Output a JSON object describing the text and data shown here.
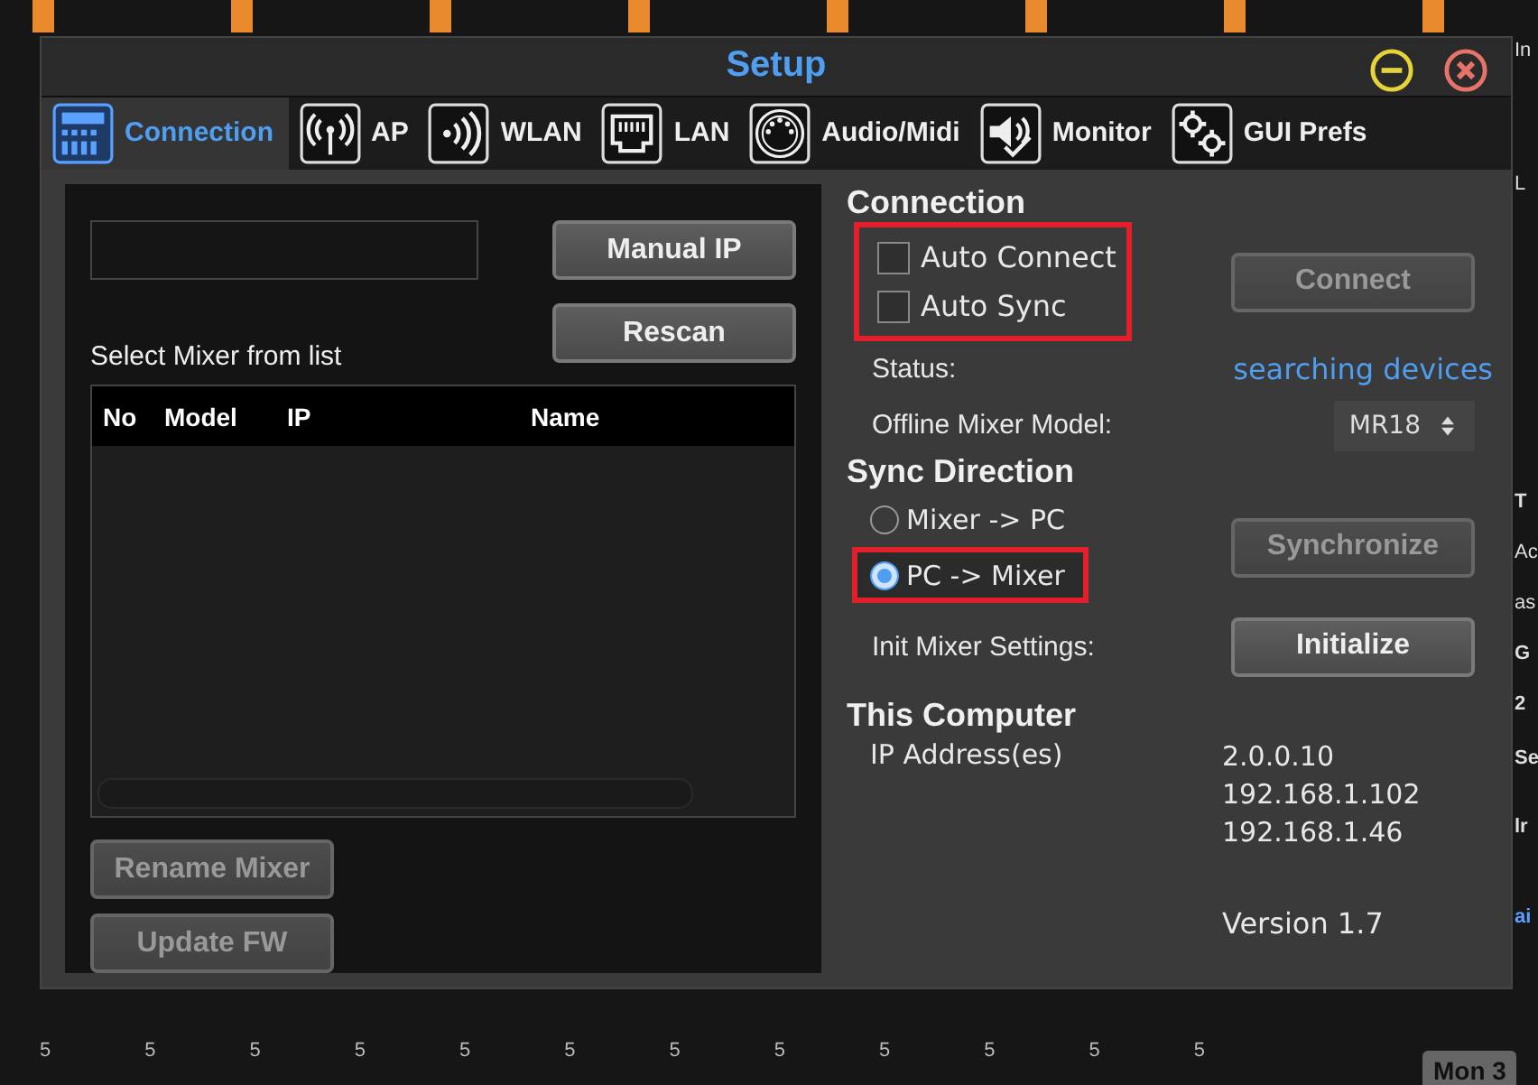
{
  "background": {
    "right_edge_labels": [
      "In",
      "L",
      "T",
      "Ac",
      "as",
      "G",
      "2",
      "Se",
      "lr",
      "ai"
    ],
    "fader_scale_marks": [
      "5",
      "5",
      "5",
      "5",
      "5",
      "5",
      "5",
      "5",
      "5",
      "5",
      "5",
      "5"
    ],
    "channel_label": "Mon 3"
  },
  "window": {
    "title": "Setup"
  },
  "tabs": [
    {
      "label": "Connection",
      "selected": true
    },
    {
      "label": "AP",
      "selected": false
    },
    {
      "label": "WLAN",
      "selected": false
    },
    {
      "label": "LAN",
      "selected": false
    },
    {
      "label": "Audio/Midi",
      "selected": false
    },
    {
      "label": "Monitor",
      "selected": false
    },
    {
      "label": "GUI Prefs",
      "selected": false
    }
  ],
  "mixer_list": {
    "buttons": [
      {
        "label": "Manual IP",
        "disabled": false
      },
      {
        "label": "Rescan",
        "disabled": false
      }
    ],
    "caption": "Select Mixer from list",
    "columns": [
      "No",
      "Model",
      "IP",
      "Name"
    ],
    "footer_buttons": [
      {
        "label": "Rename Mixer",
        "disabled": true
      },
      {
        "label": "Update FW",
        "disabled": true
      }
    ]
  },
  "connection": {
    "heading": "Connection",
    "highlighted": true,
    "options": [
      {
        "label": "Auto Connect",
        "checked": false
      },
      {
        "label": "Auto Sync",
        "checked": false
      }
    ],
    "connect_button": {
      "label": "Connect",
      "disabled": true
    },
    "status_label": "Status:",
    "status_value": "searching devices",
    "model_label": "Offline Mixer Model:",
    "model_value": "MR18"
  },
  "sync_direction": {
    "heading": "Sync Direction",
    "options": [
      {
        "label": "Mixer -> PC",
        "selected": false,
        "highlighted": false
      },
      {
        "label": "PC -> Mixer",
        "selected": true,
        "highlighted": true
      }
    ],
    "sync_button": {
      "label": "Synchronize",
      "disabled": true
    },
    "init_label": "Init Mixer Settings:",
    "init_button": {
      "label": "Initialize",
      "disabled": false
    }
  },
  "this_computer": {
    "heading": "This Computer",
    "ip_label": "IP Address(es)",
    "ip_addresses": [
      "2.0.0.10",
      "192.168.1.102",
      "192.168.1.46"
    ],
    "version": "Version 1.7"
  }
}
